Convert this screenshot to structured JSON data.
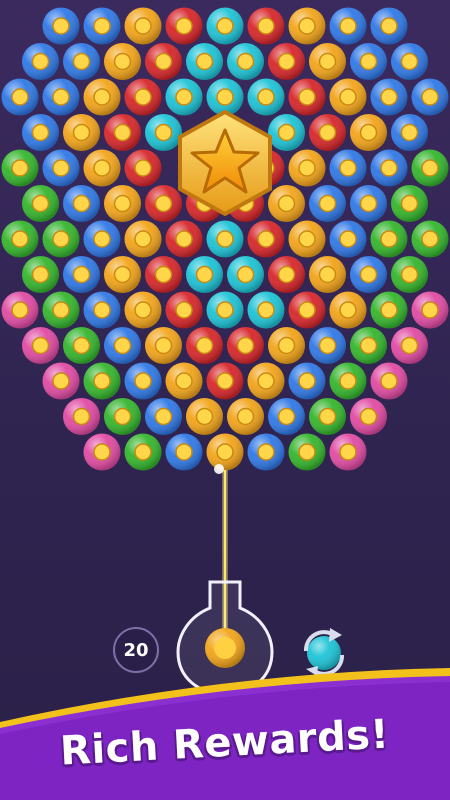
{
  "game": {
    "shots_remaining": "20",
    "banner_title": "Rich Rewards!"
  },
  "colors": {
    "blue": "#2f78e6",
    "gold": "#f2a41a",
    "red": "#d7262a",
    "cyan": "#1cc3d6",
    "green": "#34b52c",
    "pink": "#e04aa3",
    "banner": "#8b2fd1",
    "banner_edge": "#f2c11b",
    "aim_line": "#ffe866"
  },
  "grid": {
    "rows": [
      [
        "blue",
        "blue",
        "gold",
        "red",
        "cyan",
        "red",
        "gold",
        "blue",
        "blue"
      ],
      [
        "blue",
        "blue",
        "gold",
        "red",
        "cyan",
        "cyan",
        "red",
        "gold",
        "blue",
        "blue"
      ],
      [
        "blue",
        "blue",
        "gold",
        "red",
        "cyan",
        "cyan",
        "cyan",
        "red",
        "gold",
        "blue",
        "blue"
      ],
      [
        "blue",
        "gold",
        "red",
        "cyan",
        "",
        "",
        "cyan",
        "red",
        "gold",
        "blue"
      ],
      [
        "green",
        "blue",
        "gold",
        "red",
        "",
        "",
        "red",
        "gold",
        "blue",
        "blue",
        "green"
      ],
      [
        "green",
        "blue",
        "gold",
        "red",
        "red",
        "red",
        "gold",
        "blue",
        "blue",
        "green"
      ],
      [
        "green",
        "green",
        "blue",
        "gold",
        "red",
        "cyan",
        "red",
        "gold",
        "blue",
        "green",
        "green"
      ],
      [
        "green",
        "blue",
        "gold",
        "red",
        "cyan",
        "cyan",
        "red",
        "gold",
        "blue",
        "green"
      ],
      [
        "pink",
        "green",
        "blue",
        "gold",
        "red",
        "cyan",
        "cyan",
        "red",
        "gold",
        "green",
        "pink"
      ],
      [
        "pink",
        "green",
        "blue",
        "gold",
        "red",
        "red",
        "gold",
        "blue",
        "green",
        "pink"
      ],
      [
        "pink",
        "green",
        "blue",
        "gold",
        "red",
        "gold",
        "blue",
        "green",
        "pink"
      ],
      [
        "pink",
        "green",
        "blue",
        "gold",
        "gold",
        "blue",
        "green",
        "pink"
      ],
      [
        "pink",
        "green",
        "blue",
        "gold",
        "blue",
        "green",
        "pink"
      ]
    ]
  },
  "loaded_bubble": "gold",
  "next_bubble": "cyan"
}
